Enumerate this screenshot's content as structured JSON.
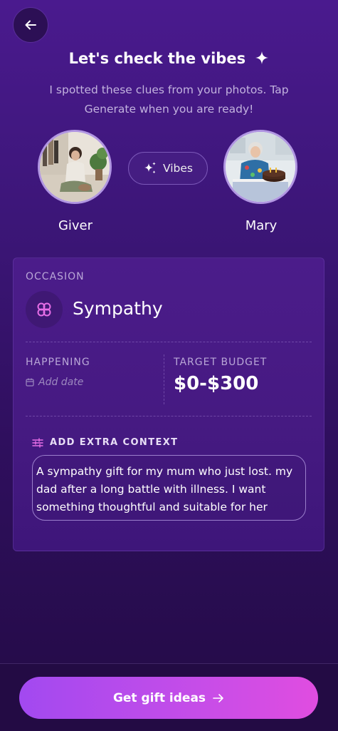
{
  "header": {
    "title": "Let's check the vibes",
    "subtitle": "I spotted these clues from your photos. Tap Generate when you are ready!"
  },
  "people": {
    "giver": {
      "name": "Giver"
    },
    "recipient": {
      "name": "Mary"
    },
    "vibes_label": "Vibes"
  },
  "occasion": {
    "label": "OCCASION",
    "value": "Sympathy"
  },
  "happening": {
    "label": "HAPPENING",
    "placeholder": "Add date"
  },
  "budget": {
    "label": "TARGET BUDGET",
    "value": "$0-$300"
  },
  "context": {
    "label": "ADD EXTRA CONTEXT",
    "value": "A sympathy gift for my mum who just lost. my dad after a long  battle with illness. I want something thoughtful and suitable for her"
  },
  "cta": {
    "label": "Get gift ideas"
  },
  "colors": {
    "background_top": "#4a1a8e",
    "background_bottom": "#230b45",
    "cta_start": "#a249f0",
    "cta_end": "#e04de0",
    "accent_pink": "#e66ee6"
  },
  "icons": {
    "back": "arrow-left-icon",
    "title": "sparkle-icon",
    "vibes": "sparkles-icon",
    "occasion": "flower-knot-icon",
    "date": "calendar-icon",
    "context": "sliders-icon",
    "cta": "arrow-right-icon"
  }
}
